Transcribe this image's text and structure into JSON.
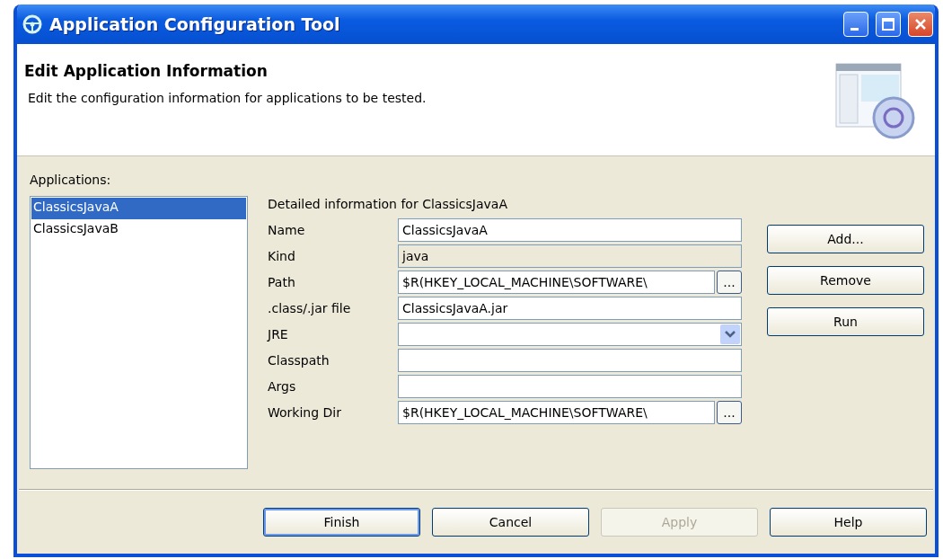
{
  "window": {
    "title": "Application Configuration Tool"
  },
  "header": {
    "title": "Edit Application Information",
    "description": "Edit the configuration information for applications to be tested."
  },
  "applications": {
    "label": "Applications:",
    "items": [
      {
        "label": "ClassicsJavaA",
        "selected": true
      },
      {
        "label": "ClassicsJavaB",
        "selected": false
      }
    ]
  },
  "details": {
    "title": "Detailed information for ClassicsJavaA",
    "fields": [
      {
        "label": "Name",
        "kind": "text",
        "value": "ClassicsJavaA"
      },
      {
        "label": "Kind",
        "kind": "readonly",
        "value": "java"
      },
      {
        "label": "Path",
        "kind": "browse",
        "value": "$R(HKEY_LOCAL_MACHINE\\SOFTWARE\\",
        "button": "..."
      },
      {
        "label": ".class/.jar file",
        "kind": "text",
        "value": "ClassicsJavaA.jar"
      },
      {
        "label": "JRE",
        "kind": "dropdown"
      },
      {
        "label": "Classpath",
        "kind": "text"
      },
      {
        "label": "Args",
        "kind": "text"
      },
      {
        "label": "Working Dir",
        "kind": "browse",
        "value": "$R(HKEY_LOCAL_MACHINE\\SOFTWARE\\",
        "button": "..."
      }
    ]
  },
  "side_buttons": [
    {
      "label": "Add..."
    },
    {
      "label": "Remove"
    },
    {
      "label": "Run"
    }
  ],
  "footer_buttons": [
    {
      "label": "Finish",
      "default": true,
      "disabled": false
    },
    {
      "label": "Cancel",
      "default": false,
      "disabled": false
    },
    {
      "label": "Apply",
      "default": false,
      "disabled": true
    },
    {
      "label": "Help",
      "default": false,
      "disabled": false
    }
  ]
}
